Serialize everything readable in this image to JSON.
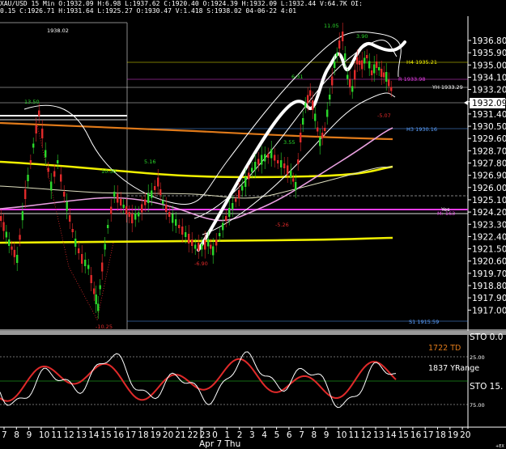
{
  "header": {
    "line1": "XAU/USD 15 Min O:1932.09 H:6.98 L:1937.62 C:1920.40 O:1924.39 H:1932.09 L:1932.44 V:64.7K OI:",
    "line2": "0.15 C:1926.71 H:1931.64 L:1925.27 O:1930.47 V:1.418 S:1938.02 04-06-22 4:01"
  },
  "price_axis": {
    "ticks": [
      "1936.80",
      "1935.90",
      "1935.00",
      "1934.10",
      "1933.20",
      "1932.30",
      "1931.40",
      "1930.50",
      "1929.60",
      "1928.70",
      "1927.80",
      "1926.90",
      "1926.00",
      "1925.10",
      "1924.20",
      "1923.30",
      "1922.40",
      "1921.50",
      "1920.60",
      "1919.70",
      "1918.80",
      "1917.90",
      "1917.00"
    ],
    "current_price": "1932.09"
  },
  "price_labels": {
    "top_value": "1938.02",
    "h4": "H4 1935.21",
    "r": "R 1933.98",
    "yh": "YH 1933.29",
    "h3": "H3 1930.16",
    "s1": "S1 1915.59",
    "vwap": "VWAP",
    "annot_left": "13.50",
    "annot_mid1": "10.30",
    "annot_mid2": "5.16",
    "annot_low1": "-6.90",
    "annot_low2": "-5.26",
    "annot_bottom": "-10.25",
    "annot_peak": "11.05",
    "annot_peak2": "3.90",
    "annot_mid3": "6.31",
    "annot_mid4": "3.55",
    "annot_neg": "-5.07",
    "annot_yes": "Yes",
    "annot_m": "M: 163"
  },
  "oscillator": {
    "label_td": "1722 TD",
    "label_yr": "1837 YRange",
    "sto_top": "STO 0.0",
    "axis_25": "25.00",
    "axis_75": "75.00",
    "sto_mid": "STO 15."
  },
  "time_axis": {
    "ticks": [
      "7",
      "8",
      "9",
      "10",
      "11",
      "12",
      "13",
      "14",
      "15",
      "16",
      "17",
      "18",
      "19",
      "20",
      "21",
      "22",
      "23",
      "0",
      "1",
      "2",
      "3",
      "4",
      "5",
      "6",
      "7",
      "8",
      "9",
      "10",
      "11",
      "12",
      "13",
      "14",
      "15",
      "16",
      "17",
      "18",
      "19",
      "20"
    ],
    "date_label": "Apr 7 Thu",
    "corner": "+EX"
  },
  "colors": {
    "bull": "#2bd82b",
    "bear": "#e02a2a",
    "yellow_ma": "#f0f000",
    "orange_ma": "#e07a1a",
    "pink_ma": "#e9a0e0",
    "magenta_line": "#e63ee6"
  }
}
